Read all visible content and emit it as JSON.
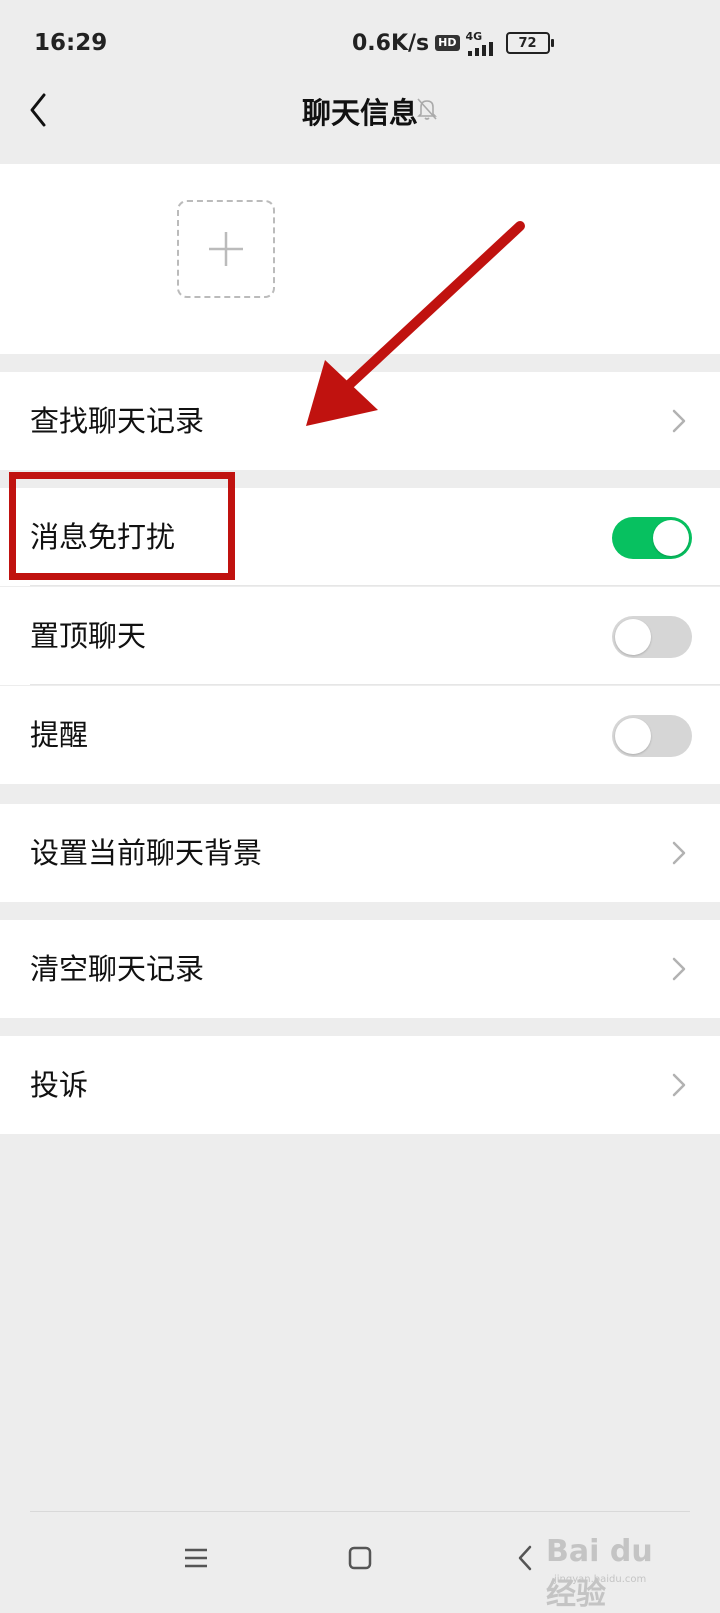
{
  "status_bar": {
    "time": "16:29",
    "net_speed": "0.6K/s",
    "hd_badge": "HD",
    "network": "4G",
    "battery": "72"
  },
  "header": {
    "title": "聊天信息",
    "back_icon": "chevron-left-icon",
    "mute_icon": "bell-off-icon"
  },
  "members": {
    "add_icon": "plus-icon"
  },
  "settings": {
    "search_history": "查找聊天记录",
    "mute_notifications": {
      "label": "消息免打扰",
      "on": true
    },
    "pin_chat": {
      "label": "置顶聊天",
      "on": false
    },
    "remind": {
      "label": "提醒",
      "on": false
    },
    "set_background": "设置当前聊天背景",
    "clear_history": "清空聊天记录",
    "report": "投诉"
  },
  "colors": {
    "toggle_on": "#07c160",
    "toggle_off": "#d6d6d6",
    "annotation": "#c0120f",
    "background": "#ededed"
  },
  "navigation": {
    "menu_icon": "menu-icon",
    "home_icon": "square-icon",
    "back_icon": "triangle-back-icon"
  },
  "watermark": {
    "text": "Bai du 经验",
    "sub": "jingyan.baidu.com"
  }
}
